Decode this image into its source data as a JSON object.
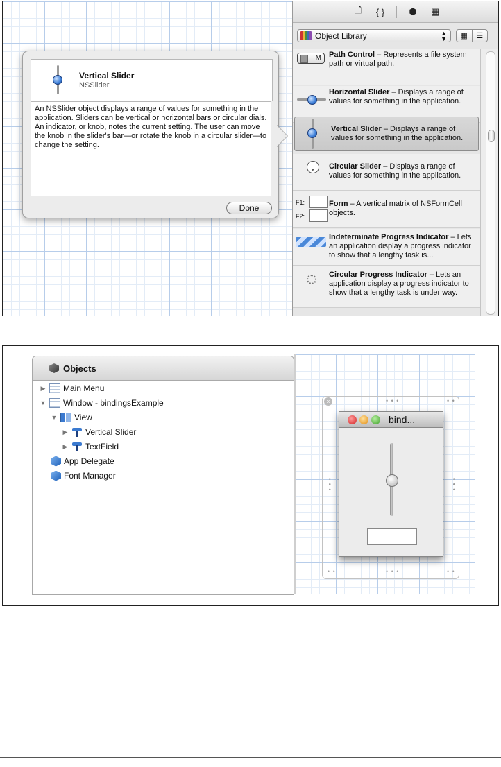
{
  "library": {
    "toolbar_icons": [
      "file-icon",
      "braces-icon",
      "cube-icon",
      "film-icon"
    ],
    "selector": {
      "label": "Object Library"
    },
    "items": [
      {
        "title": "Path Control",
        "desc": " – Represents a file system path or virtual path.",
        "icon_text": "M"
      },
      {
        "title": "Horizontal Slider",
        "desc": " – Displays a range of values for something in the application."
      },
      {
        "title": "Vertical Slider",
        "desc": " – Displays a range of values for something in the application.",
        "selected": true
      },
      {
        "title": "Circular Slider",
        "desc": " – Displays a range of values for something in the application."
      },
      {
        "title": "Form",
        "desc": " – A vertical matrix of NSFormCell objects.",
        "labels": [
          "F1:",
          "F2:"
        ]
      },
      {
        "title": "Indeterminate Progress Indicator",
        "desc": " – Lets an application display a progress indicator to show that a lengthy task is..."
      },
      {
        "title": "Circular Progress Indicator",
        "desc": " – Lets an application display a progress indicator to show that a lengthy task is under way."
      }
    ]
  },
  "popover": {
    "title": "Vertical Slider",
    "subtitle": "NSSlider",
    "body": "An NSSlider object displays a range of values for something in the application. Sliders can be vertical or horizontal bars or circular dials. An indicator, or knob, notes the current setting. The user can move the knob in the slider's bar—or rotate the knob in a circular slider—to change the setting.",
    "done_label": "Done"
  },
  "objects": {
    "header": "Objects",
    "tree": [
      {
        "label": "Main Menu",
        "level": 0,
        "disclosure": "▶",
        "icon": "menu-icon"
      },
      {
        "label": "Window - bindingsExample",
        "level": 0,
        "disclosure": "▼",
        "icon": "window-icon"
      },
      {
        "label": "View",
        "level": 1,
        "disclosure": "▼",
        "icon": "view-icon"
      },
      {
        "label": "Vertical Slider",
        "level": 2,
        "disclosure": "▶",
        "icon": "control-icon"
      },
      {
        "label": "TextField",
        "level": 2,
        "disclosure": "▶",
        "icon": "control-icon"
      },
      {
        "label": "App Delegate",
        "level": 0,
        "disclosure": "",
        "icon": "object-cube-icon"
      },
      {
        "label": "Font Manager",
        "level": 0,
        "disclosure": "",
        "icon": "object-cube-icon"
      }
    ]
  },
  "window": {
    "title": "bind...",
    "slider_value": 0.5
  }
}
